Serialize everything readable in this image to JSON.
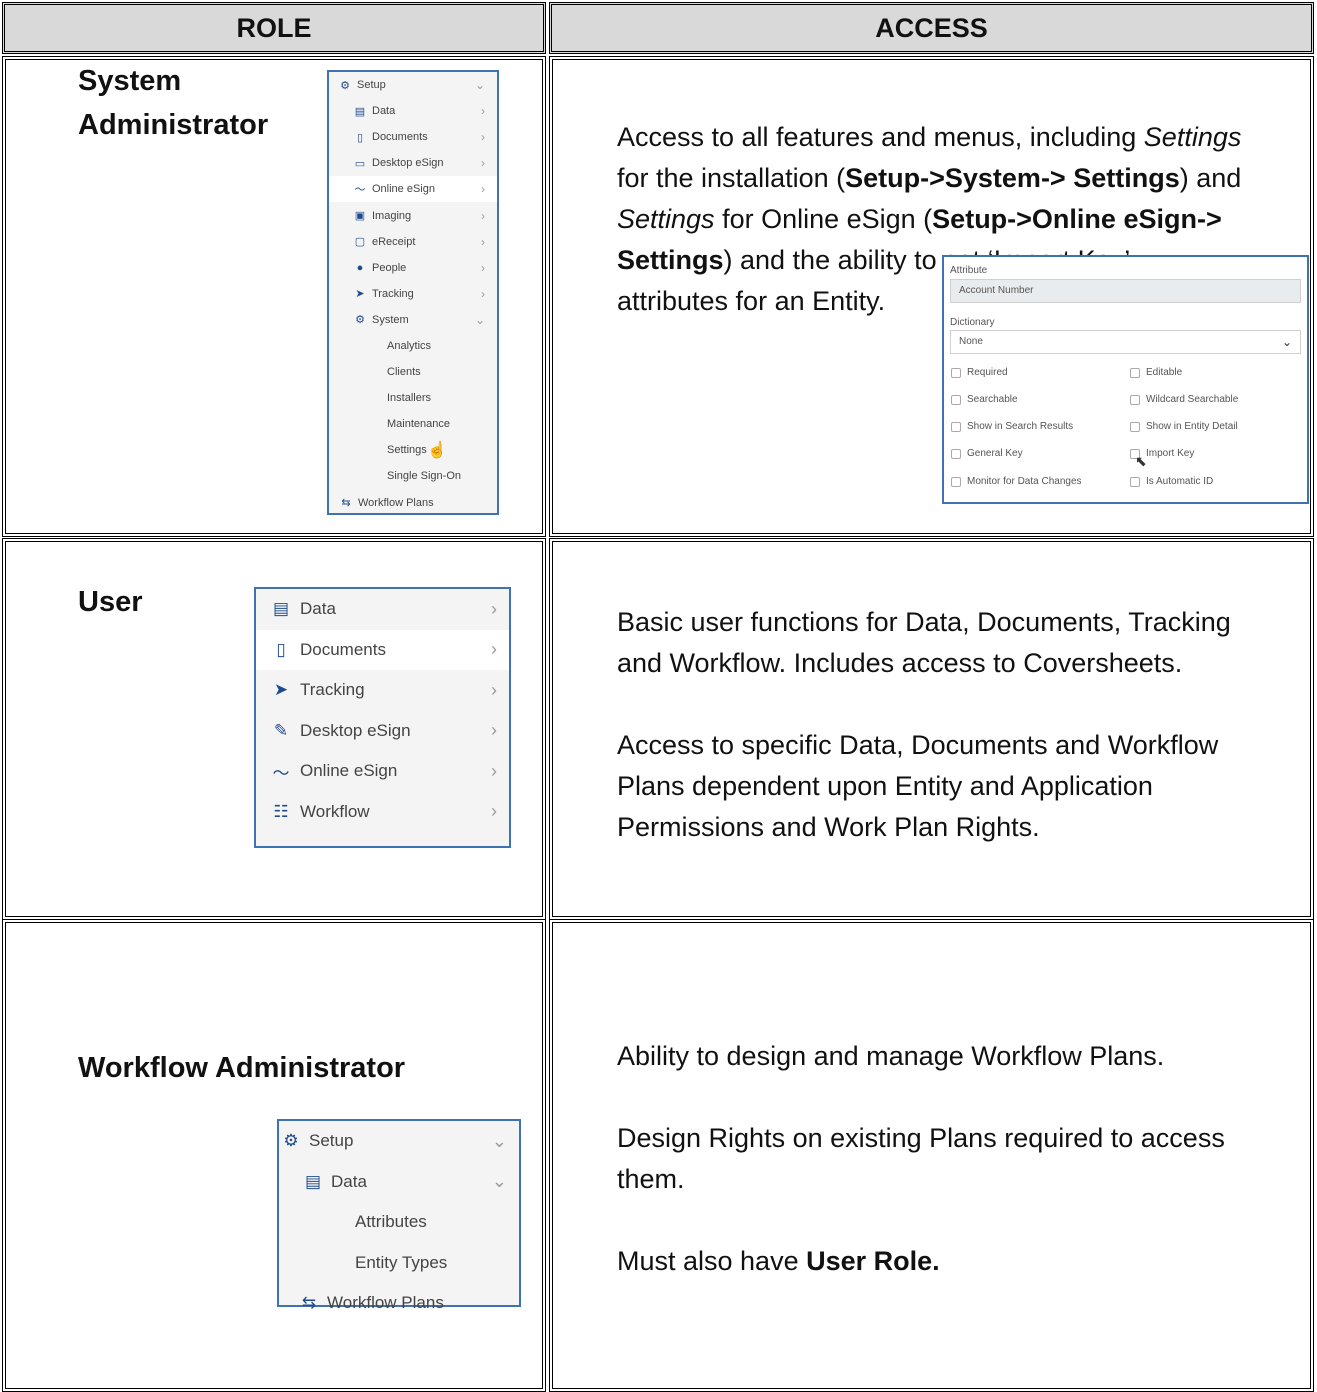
{
  "table": {
    "headers": {
      "role": "ROLE",
      "access": "ACCESS"
    }
  },
  "rows": {
    "system_admin": {
      "role_line1": "System",
      "role_line2": "Administrator",
      "access": {
        "l1a": "Access to all features and menus, including ",
        "l1b": "Settings",
        "l2a": "for the installation (",
        "l2b": "Setup->System-> Settings",
        "l2c": ") and",
        "l3a": "Settings",
        "l3b": " for Online eSign (",
        "l3c": "Setup->Online eSign->",
        "l4a": "Settings",
        "l4b": ") and the ability to set ‘Import Key’",
        "l5": "attributes for an Entity."
      },
      "menu": [
        {
          "label": "Setup",
          "icon": "gear-icon"
        },
        {
          "label": "Data",
          "icon": "database-icon"
        },
        {
          "label": "Documents",
          "icon": "clipboard-icon"
        },
        {
          "label": "Desktop eSign",
          "icon": "monitor-icon"
        },
        {
          "label": "Online eSign",
          "icon": "signature-icon"
        },
        {
          "label": "Imaging",
          "icon": "image-icon"
        },
        {
          "label": "eReceipt",
          "icon": "receipt-icon"
        },
        {
          "label": "People",
          "icon": "users-icon"
        },
        {
          "label": "Tracking",
          "icon": "location-arrow-icon"
        },
        {
          "label": "System",
          "icon": "cogs-icon"
        },
        {
          "label": "Analytics"
        },
        {
          "label": "Clients"
        },
        {
          "label": "Installers"
        },
        {
          "label": "Maintenance"
        },
        {
          "label": "Settings"
        },
        {
          "label": "Single Sign-On"
        },
        {
          "label": "Workflow Plans",
          "icon": "retweet-icon"
        }
      ],
      "form": {
        "attribute_label": "Attribute",
        "attribute_value": "Account Number",
        "dictionary_label": "Dictionary",
        "dictionary_value": "None",
        "checkboxes": [
          "Required",
          "Editable",
          "Searchable",
          "Wildcard Searchable",
          "Show in Search Results",
          "Show in Entity Detail",
          "General Key",
          "Import Key",
          "Monitor for Data Changes",
          "Is Automatic ID"
        ]
      }
    },
    "user": {
      "role": "User",
      "access_p1_l1": "Basic user functions for Data, Documents, Tracking",
      "access_p1_l2": "and Workflow.  Includes access to Coversheets.",
      "access_p2_l1": "Access to specific Data, Documents and Workflow",
      "access_p2_l2": "Plans dependent upon Entity and Application",
      "access_p2_l3": "Permissions and Work Plan Rights.",
      "menu": [
        {
          "label": "Data",
          "icon": "database-icon"
        },
        {
          "label": "Documents",
          "icon": "clipboard-icon"
        },
        {
          "label": "Tracking",
          "icon": "location-arrow-icon"
        },
        {
          "label": "Desktop eSign",
          "icon": "pencil-icon"
        },
        {
          "label": "Online eSign",
          "icon": "signature-icon"
        },
        {
          "label": "Workflow",
          "icon": "sitemap-icon"
        }
      ]
    },
    "workflow_admin": {
      "role": "Workflow Administrator",
      "access_p1": "Ability to design and manage Workflow Plans.",
      "access_p2_l1": "Design Rights on existing Plans required to access",
      "access_p2_l2": "them.",
      "access_p3_a": "Must also have ",
      "access_p3_b": "User Role.",
      "menu": [
        {
          "label": "Setup",
          "icon": "gear-icon"
        },
        {
          "label": "Data",
          "icon": "database-icon"
        },
        {
          "label": "Attributes"
        },
        {
          "label": "Entity Types"
        },
        {
          "label": "Workflow Plans",
          "icon": "retweet-icon"
        }
      ]
    }
  }
}
